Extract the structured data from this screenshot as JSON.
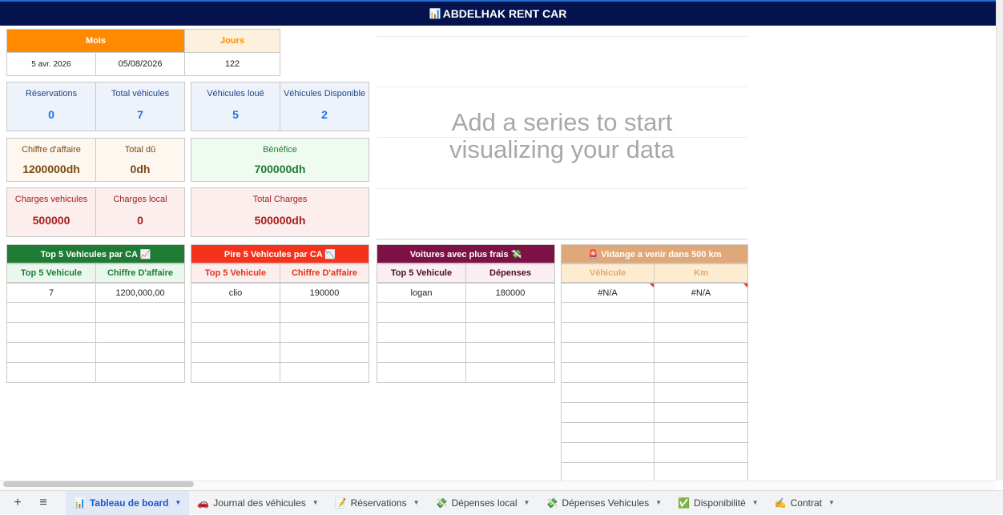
{
  "title": {
    "icon": "📊",
    "text": "ABDELHAK RENT CAR"
  },
  "period": {
    "mois_label": "Mois",
    "jours_label": "Jours",
    "start": "5 avr. 2026",
    "end": "05/08/2026",
    "jours": "122"
  },
  "kpis": {
    "reservations": {
      "label": "Réservations",
      "value": "0"
    },
    "total_vehicules": {
      "label": "Total véhicules",
      "value": "7"
    },
    "vehicules_loue": {
      "label": "Véhicules loué",
      "value": "5"
    },
    "vehicules_dispo": {
      "label": "Véhicules Disponible",
      "value": "2"
    },
    "chiffre": {
      "label": "Chiffre d'affaire",
      "value": "1200000dh"
    },
    "total_du": {
      "label": "Total dû",
      "value": "0dh"
    },
    "benefice": {
      "label": "Bénéfice",
      "value": "700000dh"
    },
    "charges_veh": {
      "label": "Charges vehicules",
      "value": "500000"
    },
    "charges_local": {
      "label": "Charges local",
      "value": "0"
    },
    "total_charges": {
      "label": "Total Charges",
      "value": "500000dh"
    }
  },
  "chart": {
    "placeholder_line1": "Add a series to start",
    "placeholder_line2": "visualizing your data"
  },
  "top5": {
    "title": "Top 5 Vehicules par CA 📈",
    "col1": "Top 5 Vehicule",
    "col2": "Chiffre D'affaire",
    "rows": [
      [
        "7",
        "1200,000,00"
      ],
      [
        "",
        ""
      ],
      [
        "",
        ""
      ],
      [
        "",
        ""
      ],
      [
        "",
        ""
      ]
    ]
  },
  "pire5": {
    "title": "Pire 5 Vehicules par CA 📉",
    "col1": "Top 5 Vehicule",
    "col2": "Chiffre D'affaire",
    "rows": [
      [
        "clio",
        "190000"
      ],
      [
        "",
        ""
      ],
      [
        "",
        ""
      ],
      [
        "",
        ""
      ],
      [
        "",
        ""
      ]
    ]
  },
  "frais": {
    "title": "Voitures avec plus frais 💸",
    "col1": "Top 5 Vehicule",
    "col2": "Dépenses",
    "rows": [
      [
        "logan",
        "180000"
      ],
      [
        "",
        ""
      ],
      [
        "",
        ""
      ],
      [
        "",
        ""
      ],
      [
        "",
        ""
      ]
    ]
  },
  "vidange": {
    "title": "🚨 Vidange a venir dans 500 km",
    "col1": "Véhicule",
    "col2": "Km",
    "rows": [
      [
        "#N/A",
        "#N/A"
      ],
      [
        "",
        ""
      ],
      [
        "",
        ""
      ],
      [
        "",
        ""
      ],
      [
        "",
        ""
      ],
      [
        "",
        ""
      ],
      [
        "",
        ""
      ],
      [
        "",
        ""
      ],
      [
        "",
        ""
      ],
      [
        "",
        ""
      ]
    ]
  },
  "tabs": [
    {
      "icon": "📊",
      "label": "Tableau de board"
    },
    {
      "icon": "🚗",
      "label": "Journal des véhicules"
    },
    {
      "icon": "📝",
      "label": "Réservations"
    },
    {
      "icon": "💸",
      "label": "Dépenses local"
    },
    {
      "icon": "💸",
      "label": "Dépenses Vehicules"
    },
    {
      "icon": "✅",
      "label": "Disponibilité"
    },
    {
      "icon": "✍",
      "label": "Contrat"
    }
  ],
  "toolbar": {
    "add": "+",
    "menu": "≡",
    "dropdown": "▼"
  },
  "colors": {
    "title_bg": "#04124d",
    "orange": "#ff8a00",
    "green": "#1e7b34",
    "red": "#f5331d",
    "maroon": "#7d1044",
    "tan": "#e0a878",
    "kpi_blue_bg": "#eef2fb"
  }
}
